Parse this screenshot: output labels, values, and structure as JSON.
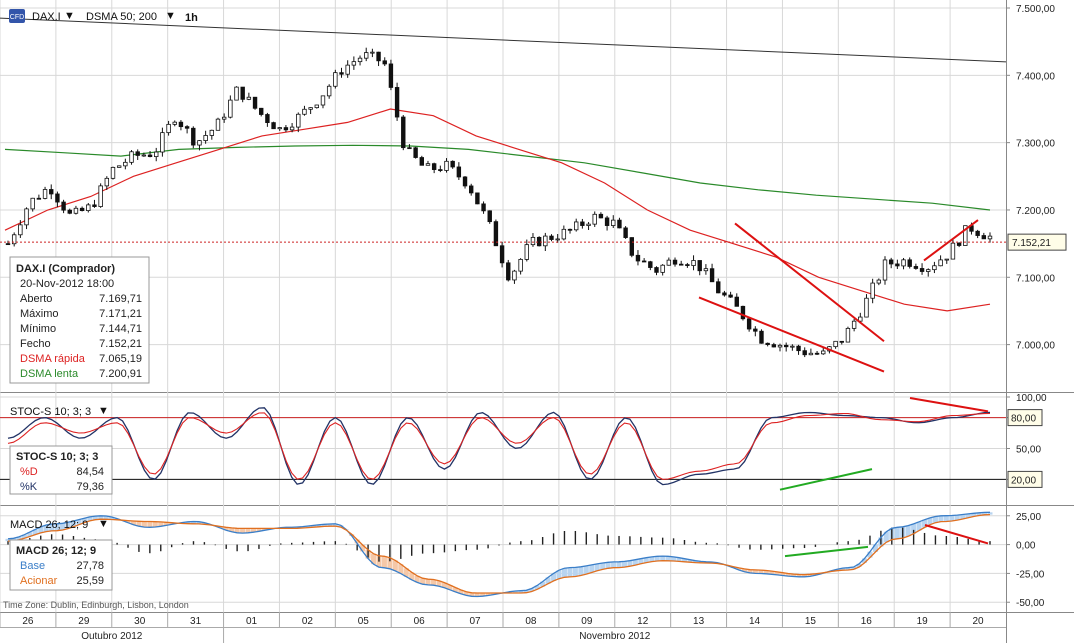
{
  "toolbar": {
    "symbol": "DAX.I",
    "indicator": "DSMA 50; 200",
    "timeframe": "1h",
    "logo": "cfd-logo-icon"
  },
  "colors": {
    "price_up": "#ffffff",
    "price_down": "#111111",
    "dsma_fast": "#dd2222",
    "dsma_slow": "#2a8a2a",
    "stoch_d": "#dd2222",
    "stoch_k": "#223366",
    "macd_base": "#3a7ec8",
    "macd_signal": "#e07020",
    "trendline_red": "#dd1111",
    "trendline_green": "#22aa22",
    "grid": "#d8d8d8"
  },
  "info_box": {
    "title": "DAX.I (Comprador)",
    "datetime": "20-Nov-2012 18:00",
    "rows": [
      {
        "label": "Aberto",
        "value": "7.169,71",
        "color": "#222222"
      },
      {
        "label": "Máximo",
        "value": "7.171,21",
        "color": "#222222"
      },
      {
        "label": "Mínimo",
        "value": "7.144,71",
        "color": "#222222"
      },
      {
        "label": "Fecho",
        "value": "7.152,21",
        "color": "#222222"
      },
      {
        "label": "DSMA rápida",
        "value": "7.065,19",
        "color": "#dd2222"
      },
      {
        "label": "DSMA lenta",
        "value": "7.200,91",
        "color": "#2a8a2a"
      }
    ]
  },
  "stoch_box": {
    "header": "STOC-S 10; 3; 3",
    "title": "STOC-S 10; 3; 3",
    "rows": [
      {
        "label": "%D",
        "value": "84,54",
        "color": "#dd2222"
      },
      {
        "label": "%K",
        "value": "79,36",
        "color": "#223366"
      }
    ]
  },
  "macd_box": {
    "header": "MACD 26; 12; 9",
    "title": "MACD 26; 12; 9",
    "rows": [
      {
        "label": "Base",
        "value": "27,78",
        "color": "#3a7ec8"
      },
      {
        "label": "Acionar",
        "value": "25,59",
        "color": "#e07020"
      }
    ]
  },
  "timezone": "Time Zone: Dublin, Edinburgh, Lisbon, London",
  "chart_data": {
    "type": "line",
    "x_dates": [
      "26",
      "29",
      "30",
      "31",
      "01",
      "02",
      "05",
      "06",
      "07",
      "08",
      "09",
      "12",
      "13",
      "14",
      "15",
      "16",
      "19",
      "20"
    ],
    "months": [
      "Outubro 2012",
      "Novembro 2012"
    ],
    "price_panel": {
      "y_ticks": [
        "7.500,00",
        "7.400,00",
        "7.300,00",
        "7.200,00",
        "7.100,00",
        "7.000,00"
      ],
      "y_tick_values": [
        7500,
        7400,
        7300,
        7200,
        7100,
        7000
      ],
      "ylim": [
        6940,
        7500
      ],
      "last_price": 7152.21,
      "last_price_label": "7.152,21",
      "close_path": [
        7150,
        7210,
        7235,
        7190,
        7205,
        7260,
        7280,
        7285,
        7340,
        7300,
        7325,
        7380,
        7345,
        7320,
        7340,
        7370,
        7410,
        7430,
        7420,
        7290,
        7260,
        7265,
        7240,
        7180,
        7100,
        7150,
        7160,
        7170,
        7190,
        7180,
        7130,
        7110,
        7130,
        7120,
        7080,
        7050,
        7010,
        7000,
        6990,
        6985,
        7010,
        7060,
        7120,
        7125,
        7115,
        7135,
        7175,
        7160
      ],
      "dsma_fast_path": [
        7170,
        7200,
        7220,
        7250,
        7270,
        7290,
        7310,
        7320,
        7330,
        7350,
        7340,
        7310,
        7290,
        7270,
        7240,
        7200,
        7170,
        7150,
        7130,
        7100,
        7080,
        7060,
        7050,
        7060
      ],
      "dsma_slow_path": [
        7290,
        7285,
        7280,
        7290,
        7293,
        7295,
        7296,
        7295,
        7290,
        7280,
        7270,
        7255,
        7240,
        7230,
        7222,
        7216,
        7210,
        7200
      ]
    },
    "stoch_panel": {
      "y_ticks": [
        "100,00",
        "80,00",
        "50,00",
        "20,00"
      ],
      "y_tick_values": [
        100,
        80,
        50,
        20
      ],
      "ylim": [
        0,
        100
      ],
      "label_80": "80,00",
      "label_20": "20,00",
      "k_path": [
        60,
        80,
        60,
        80,
        20,
        85,
        60,
        90,
        15,
        80,
        15,
        80,
        30,
        85,
        50,
        85,
        20,
        80,
        15,
        25,
        30,
        80,
        85,
        82,
        80,
        75,
        80,
        85
      ],
      "d_path": [
        55,
        75,
        65,
        75,
        25,
        80,
        65,
        85,
        20,
        75,
        20,
        75,
        35,
        80,
        55,
        80,
        25,
        75,
        20,
        28,
        35,
        75,
        82,
        84,
        78,
        76,
        82,
        84
      ]
    },
    "macd_panel": {
      "y_ticks": [
        "25,00",
        "0,00",
        "-25,00",
        "-50,00"
      ],
      "y_tick_values": [
        25,
        0,
        -25,
        -50
      ],
      "ylim": [
        -55,
        30
      ],
      "base_path": [
        5,
        18,
        25,
        15,
        20,
        10,
        15,
        18,
        -20,
        -35,
        -45,
        -40,
        -20,
        -15,
        -10,
        -15,
        -25,
        -28,
        -20,
        15,
        25,
        28
      ],
      "signal_path": [
        3,
        12,
        22,
        20,
        18,
        14,
        14,
        16,
        -10,
        -30,
        -42,
        -42,
        -28,
        -20,
        -14,
        -16,
        -22,
        -26,
        -22,
        5,
        20,
        26
      ]
    }
  }
}
